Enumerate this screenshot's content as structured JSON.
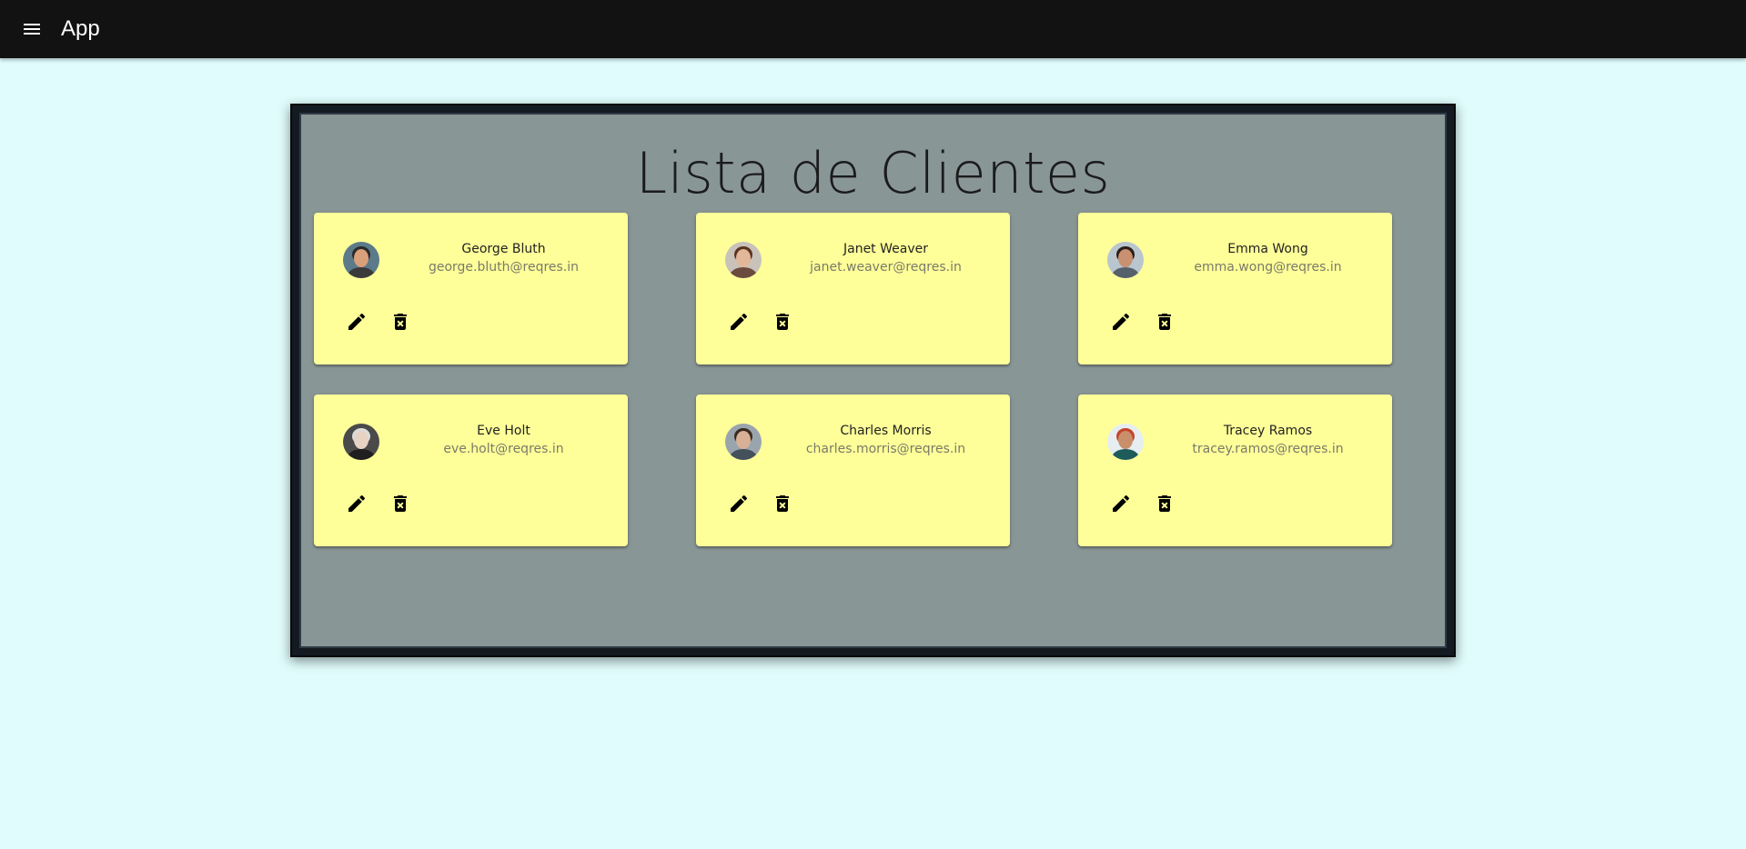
{
  "appbar": {
    "title": "App"
  },
  "main": {
    "heading": "Lista de Clientes"
  },
  "clients": [
    {
      "name": "George Bluth",
      "email": "george.bluth@reqres.in",
      "avatar_bg": "#5b7a8a",
      "skin": "#d9a07a",
      "hair": "#2a2a2a",
      "shirt": "#3a3a3a"
    },
    {
      "name": "Janet Weaver",
      "email": "janet.weaver@reqres.in",
      "avatar_bg": "#c8c2bb",
      "skin": "#e3b79a",
      "hair": "#5a3420",
      "shirt": "#6b4b3e"
    },
    {
      "name": "Emma Wong",
      "email": "emma.wong@reqres.in",
      "avatar_bg": "#b9c6cf",
      "skin": "#c99171",
      "hair": "#2a1e18",
      "shirt": "#56606a"
    },
    {
      "name": "Eve Holt",
      "email": "eve.holt@reqres.in",
      "avatar_bg": "#4a4a4a",
      "skin": "#e8d2c4",
      "hair": "#dcdcdc",
      "shirt": "#1f1f1f"
    },
    {
      "name": "Charles Morris",
      "email": "charles.morris@reqres.in",
      "avatar_bg": "#9aa4ad",
      "skin": "#d8b096",
      "hair": "#3a2a20",
      "shirt": "#44505a"
    },
    {
      "name": "Tracey Ramos",
      "email": "tracey.ramos@reqres.in",
      "avatar_bg": "#e6eef2",
      "skin": "#c98f6a",
      "hair": "#c4452a",
      "shirt": "#1e5b5b"
    }
  ],
  "icons": {
    "menu": "menu-icon",
    "edit": "pencil-icon",
    "delete": "delete-forever-icon"
  },
  "colors": {
    "appbar": "#121212",
    "page_background": "#e0fcfc",
    "panel": "#899696",
    "card": "#ffff99"
  }
}
